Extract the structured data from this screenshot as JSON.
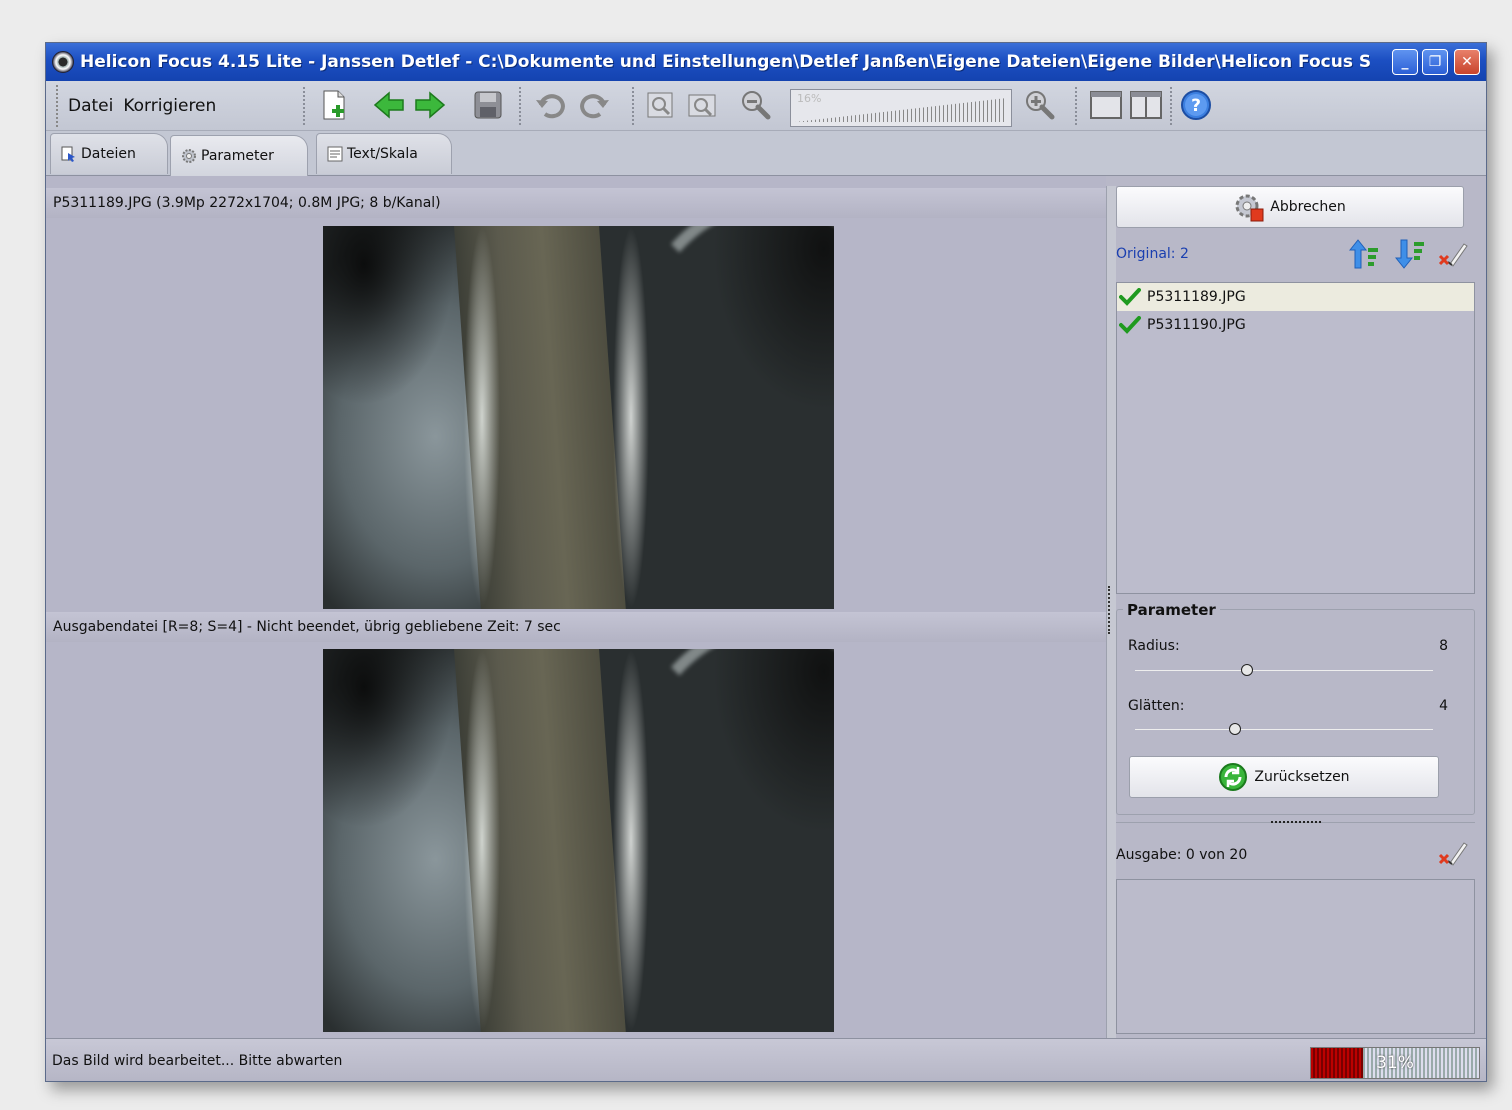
{
  "window": {
    "title": "Helicon Focus 4.15 Lite - Janssen Detlef - C:\\Dokumente und Einstellungen\\Detlef Janßen\\Eigene Dateien\\Eigene Bilder\\Helicon Focus Samples\\",
    "minimize_glyph": "_",
    "maximize_glyph": "❐",
    "close_glyph": "✕"
  },
  "menu": [
    "Datei",
    "Korrigieren"
  ],
  "toolbar": {
    "icons": [
      "new-file-icon",
      "arrow-left-icon",
      "arrow-right-icon",
      "save-icon",
      "undo-icon",
      "redo-icon",
      "zoom-fit-icon",
      "zoom-actual-icon",
      "zoom-out-icon",
      "zoom-slider",
      "zoom-in-icon",
      "single-view-icon",
      "split-view-icon",
      "help-icon"
    ],
    "zoom_label": "16%",
    "zoom_level": 0.16
  },
  "tabs": [
    {
      "label": "Dateien",
      "icon": "files-icon"
    },
    {
      "label": "Parameter",
      "icon": "gear-icon"
    },
    {
      "label": "Text/Skala",
      "icon": "text-icon"
    }
  ],
  "viewer": {
    "top_label": "P5311189.JPG (3.9Mp 2272x1704; 0.8M JPG; 8 b/Kanal)",
    "bottom_label": "Ausgabendatei [R=8; S=4] - Nicht beendet, übrig gebliebene Zeit: 7 sec"
  },
  "right": {
    "cancel_button": "Abbrechen",
    "original_label": "Original: 2",
    "files": [
      {
        "name": "P5311189.JPG",
        "checked": true,
        "selected": true
      },
      {
        "name": "P5311190.JPG",
        "checked": true,
        "selected": false
      }
    ],
    "parameter_title": "Parameter",
    "radius_label": "Radius:",
    "radius_value": "8",
    "radius_fraction": 0.37,
    "smooth_label": "Glätten:",
    "smooth_value": "4",
    "smooth_fraction": 0.33,
    "reset_button": "Zurücksetzen",
    "output_label": "Ausgabe: 0 von 20"
  },
  "status": {
    "text": "Das Bild wird bearbeitet... Bitte abwarten",
    "progress_text": "31%",
    "progress_fraction": 0.31
  },
  "colors": {
    "titlebar": "#1c4fc2",
    "progress": "#b00000",
    "accent_blue": "#1a3fb0"
  }
}
